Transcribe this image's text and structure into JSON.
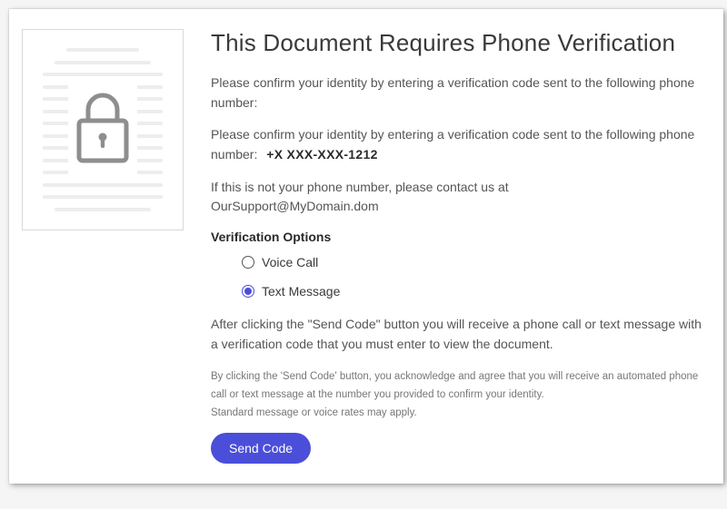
{
  "title": "This Document Requires Phone Verification",
  "instructions": {
    "line1": "Please confirm your identity by entering a verification code sent to the following phone number:",
    "line2_prefix": "Please confirm your identity by entering a verification code sent to the following phone number:",
    "phone_value": "+X XXX-XXX-1212",
    "not_your_number_prefix": "If this is not your phone number, please contact us at",
    "support_email": "OurSupport@MyDomain.dom"
  },
  "verification": {
    "heading": "Verification Options",
    "options": [
      {
        "label": "Voice Call",
        "selected": false
      },
      {
        "label": "Text Message",
        "selected": true
      }
    ]
  },
  "after_text": "After clicking the \"Send Code\" button you will receive a phone call or text message with a verification code that you must enter to view the document.",
  "disclaimer": "By clicking the 'Send Code' button, you acknowledge and agree that you will receive an automated phone call or text message at the number you provided to confirm your identity.\nStandard message or voice rates may apply.",
  "send_button": "Send Code"
}
